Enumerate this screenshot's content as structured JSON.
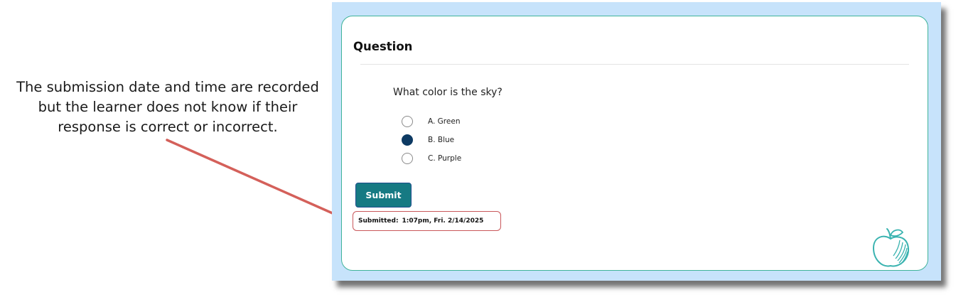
{
  "annotation": {
    "lines": [
      "The submission date and time are recorded",
      "but the learner does not know if their",
      "response is correct or incorrect."
    ]
  },
  "question": {
    "heading": "Question",
    "text": "What color is the sky?",
    "options": [
      {
        "label": "A. Green",
        "selected": false
      },
      {
        "label": "B. Blue",
        "selected": true
      },
      {
        "label": "C. Purple",
        "selected": false
      }
    ]
  },
  "submit": {
    "label": "Submit"
  },
  "submission": {
    "label": "Submitted:",
    "time": "1:07pm, Fri. 2/14/2025"
  },
  "logo": {
    "icon": "apple-icon"
  },
  "colors": {
    "frame_background": "#c7e3fb",
    "card_border": "#3fb39a",
    "submit_button": "#167a83",
    "selected_radio": "#0d3a63",
    "callout_arrow": "#d4605a"
  }
}
